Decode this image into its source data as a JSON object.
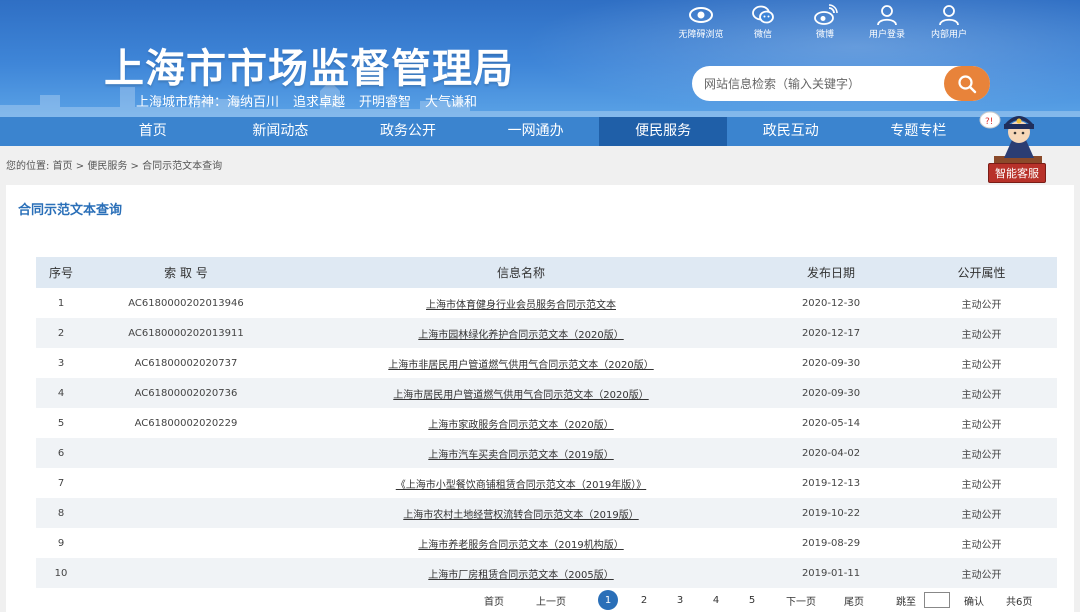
{
  "header": {
    "title": "上海市市场监督管理局",
    "slogan": [
      "上海城市精神：海纳百川",
      "追求卓越",
      "开明睿智",
      "大气谦和"
    ],
    "toplinks": [
      {
        "label": "无障碍浏览",
        "icon": "eye-icon"
      },
      {
        "label": "微信",
        "icon": "wechat-icon"
      },
      {
        "label": "微博",
        "icon": "weibo-icon"
      },
      {
        "label": "用户登录",
        "icon": "user-icon"
      },
      {
        "label": "内部用户",
        "icon": "user-icon"
      }
    ],
    "search_placeholder": "网站信息检索（输入关键字）"
  },
  "nav": [
    "首页",
    "新闻动态",
    "政务公开",
    "一网通办",
    "便民服务",
    "政民互动",
    "专题专栏"
  ],
  "nav_active": "便民服务",
  "assistant_label": "智能客服",
  "breadcrumb": {
    "prefix": "您的位置:",
    "items": [
      "首页",
      "便民服务",
      "合同示范文本查询"
    ],
    "sep": ">"
  },
  "panel_title": "合同示范文本查询",
  "table": {
    "headers": [
      "序号",
      "索 取 号",
      "信息名称",
      "发布日期",
      "公开属性"
    ],
    "rows": [
      [
        "1",
        "AC6180000202013946",
        "上海市体育健身行业会员服务合同示范文本",
        "2020-12-30",
        "主动公开"
      ],
      [
        "2",
        "AC6180000202013911",
        "上海市园林绿化养护合同示范文本（2020版）",
        "2020-12-17",
        "主动公开"
      ],
      [
        "3",
        "AC61800002020737",
        "上海市非居民用户管道燃气供用气合同示范文本（2020版）",
        "2020-09-30",
        "主动公开"
      ],
      [
        "4",
        "AC61800002020736",
        "上海市居民用户管道燃气供用气合同示范文本（2020版）",
        "2020-09-30",
        "主动公开"
      ],
      [
        "5",
        "AC61800002020229",
        "上海市家政服务合同示范文本（2020版）",
        "2020-05-14",
        "主动公开"
      ],
      [
        "6",
        "",
        "上海市汽车买卖合同示范文本（2019版）",
        "2020-04-02",
        "主动公开"
      ],
      [
        "7",
        "",
        "《上海市小型餐饮商铺租赁合同示范文本（2019年版）》",
        "2019-12-13",
        "主动公开"
      ],
      [
        "8",
        "",
        "上海市农村土地经营权流转合同示范文本（2019版）",
        "2019-10-22",
        "主动公开"
      ],
      [
        "9",
        "",
        "上海市养老服务合同示范文本（2019机构版）",
        "2019-08-29",
        "主动公开"
      ],
      [
        "10",
        "",
        "上海市厂房租赁合同示范文本（2005版）",
        "2019-01-11",
        "主动公开"
      ]
    ]
  },
  "pager": {
    "first": "首页",
    "prev": "上一页",
    "current": "1",
    "pages": [
      "2",
      "3",
      "4",
      "5"
    ],
    "next": "下一页",
    "last": "尾页",
    "jump": "跳至",
    "confirm": "确认",
    "total": "共6页"
  },
  "colors": {
    "header": "#3f86d8",
    "nav": "#3b84cf",
    "nav_active": "#1f5fa8",
    "search_button": "#e8833a",
    "accent": "#2a6fb8"
  }
}
